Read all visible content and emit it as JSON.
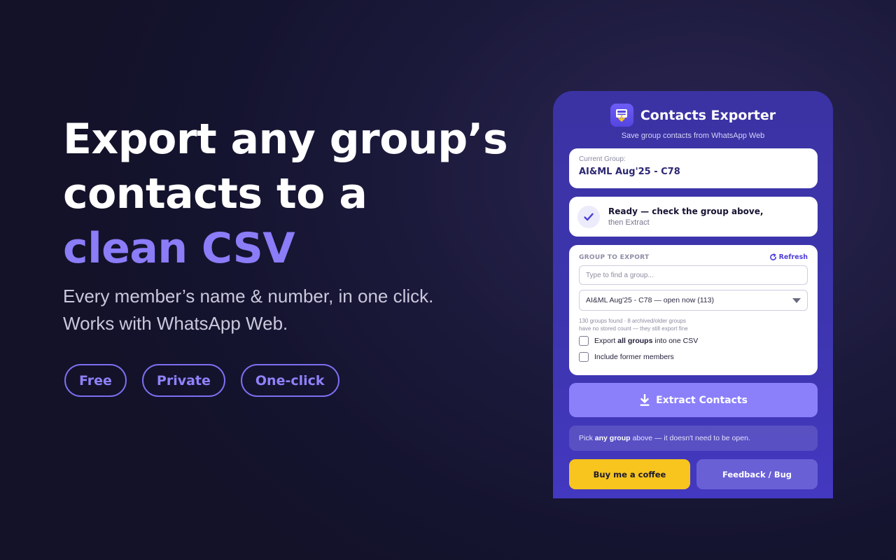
{
  "hero": {
    "headline_line1": "Export any group’s",
    "headline_line2": "contacts to a",
    "headline_accent": "clean CSV",
    "sub_line1": "Every member’s name & number, in one click.",
    "sub_line2": "Works with WhatsApp Web.",
    "pills": [
      "Free",
      "Private",
      "One-click"
    ]
  },
  "panel": {
    "icon": "contacts-export-icon",
    "title": "Contacts Exporter",
    "subtitle": "Save group contacts from WhatsApp Web",
    "current_group": {
      "label": "Current Group:",
      "value": "AI&ML Aug'25 - C78"
    },
    "status": {
      "icon": "check-icon",
      "main": "Ready — check the group above,",
      "sub": "then Extract"
    },
    "export": {
      "label": "GROUP TO EXPORT",
      "refresh_label": "Refresh",
      "search_placeholder": "Type to find a group...",
      "selected_group": "AI&ML Aug'25 - C78 — open now (113)",
      "hint_line1": "130 groups found · 8 archived/older groups",
      "hint_line2": "have no stored count — they still export fine",
      "option_all_pre": "Export ",
      "option_all_bold": "all groups",
      "option_all_post": " into one CSV",
      "option_former": "Include former members"
    },
    "extract_label": "Extract Contacts",
    "tip_pre": "Pick ",
    "tip_bold": "any group",
    "tip_post": " above — it doesn't need to be open.",
    "coffee_label": "Buy me a coffee",
    "feedback_label": "Feedback / Bug"
  },
  "colors": {
    "accent": "#8b7cf8",
    "panel_bg": "#3d35ae",
    "coffee": "#f7c51e"
  }
}
